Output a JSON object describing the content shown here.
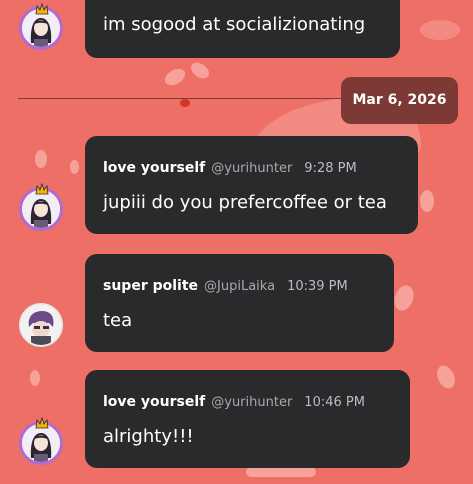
{
  "colors": {
    "background": "#ee6f66",
    "bubble": "#2a2a2c",
    "date_pill": "#7d3935",
    "handle_text": "#a9a9ad",
    "avatar_ring": "#b06ad4",
    "crown": "#f5b400"
  },
  "date_divider": {
    "label": "Mar 6, 2026"
  },
  "messages": [
    {
      "text": "im sogood at socializionating"
    },
    {
      "author": "love yourself",
      "handle": "@yurihunter",
      "time": "9:28 PM",
      "text": "jupiii do you prefercoffee or tea",
      "avatar_icon": "anime-girl-avatar-icon"
    },
    {
      "author": "super polite",
      "handle": "@JupiLaika",
      "time": "10:39 PM",
      "text": "tea",
      "avatar_icon": "purple-hair-avatar-icon"
    },
    {
      "author": "love yourself",
      "handle": "@yurihunter",
      "time": "10:46 PM",
      "text": "alrighty!!!",
      "avatar_icon": "anime-girl-avatar-icon"
    }
  ]
}
